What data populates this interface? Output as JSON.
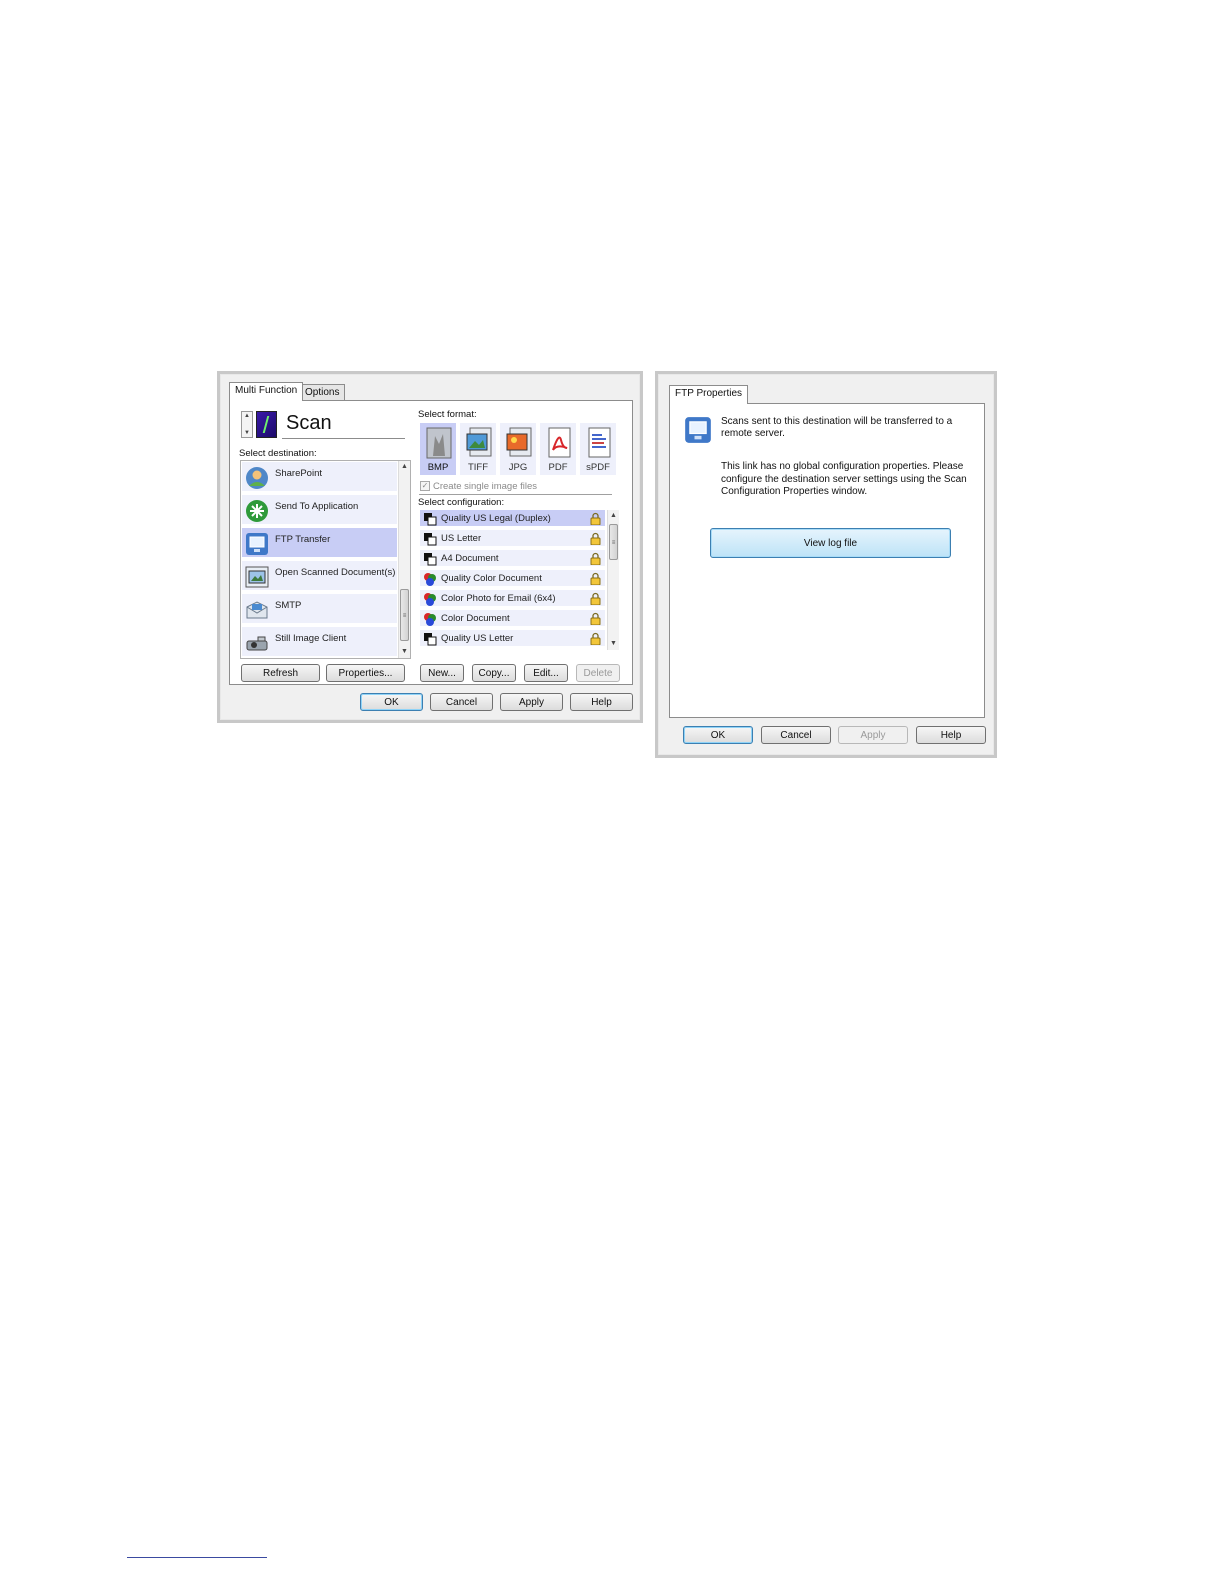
{
  "multi_function_dialog": {
    "tabs": [
      "Multi Function",
      "Options"
    ],
    "action_name": "Scan",
    "select_destination_label": "Select destination:",
    "destinations": [
      {
        "label": "SharePoint",
        "icon": "sharepoint-icon"
      },
      {
        "label": "Send To Application",
        "icon": "send-to-application-icon"
      },
      {
        "label": "FTP Transfer",
        "icon": "ftp-transfer-icon",
        "selected": true
      },
      {
        "label": "Open Scanned Document(s)",
        "icon": "open-document-icon"
      },
      {
        "label": "SMTP",
        "icon": "smtp-icon"
      },
      {
        "label": "Still Image Client",
        "icon": "still-image-client-icon"
      }
    ],
    "select_format_label": "Select format:",
    "formats": [
      {
        "label": "BMP",
        "icon": "bmp-icon",
        "selected": true
      },
      {
        "label": "TIFF",
        "icon": "tiff-icon"
      },
      {
        "label": "JPG",
        "icon": "jpg-icon"
      },
      {
        "label": "PDF",
        "icon": "pdf-icon"
      },
      {
        "label": "sPDF",
        "icon": "spdf-icon"
      }
    ],
    "create_single_image_files_label": "Create single image files",
    "create_single_image_files_checked": true,
    "select_configuration_label": "Select configuration:",
    "configurations": [
      {
        "label": "Quality US Legal (Duplex)",
        "icon": "bw-config-icon",
        "selected": true
      },
      {
        "label": "US Letter",
        "icon": "bw-config-icon"
      },
      {
        "label": "A4 Document",
        "icon": "bw-config-icon"
      },
      {
        "label": "Quality Color Document",
        "icon": "color-config-icon"
      },
      {
        "label": "Color Photo for Email (6x4)",
        "icon": "color-config-icon"
      },
      {
        "label": "Color Document",
        "icon": "color-config-icon"
      },
      {
        "label": "Quality US Letter",
        "icon": "bw-config-icon"
      }
    ],
    "buttons": {
      "refresh": "Refresh",
      "properties": "Properties...",
      "new": "New...",
      "copy": "Copy...",
      "edit": "Edit...",
      "delete": "Delete",
      "ok": "OK",
      "cancel": "Cancel",
      "apply": "Apply",
      "help": "Help"
    }
  },
  "ftp_properties_dialog": {
    "tab": "FTP Properties",
    "description": "Scans sent to this destination will be transferred to a remote server.",
    "note": "This link has no global configuration properties. Please configure the destination server settings using the Scan Configuration Properties window.",
    "view_log_button": "View log file",
    "buttons": {
      "ok": "OK",
      "cancel": "Cancel",
      "apply": "Apply",
      "help": "Help"
    }
  },
  "colors": {
    "selected_item": "#c8cdf5",
    "list_item": "#eef0fb",
    "dialog_background": "#f0f0f0",
    "default_button_border": "#3c7fb1"
  }
}
